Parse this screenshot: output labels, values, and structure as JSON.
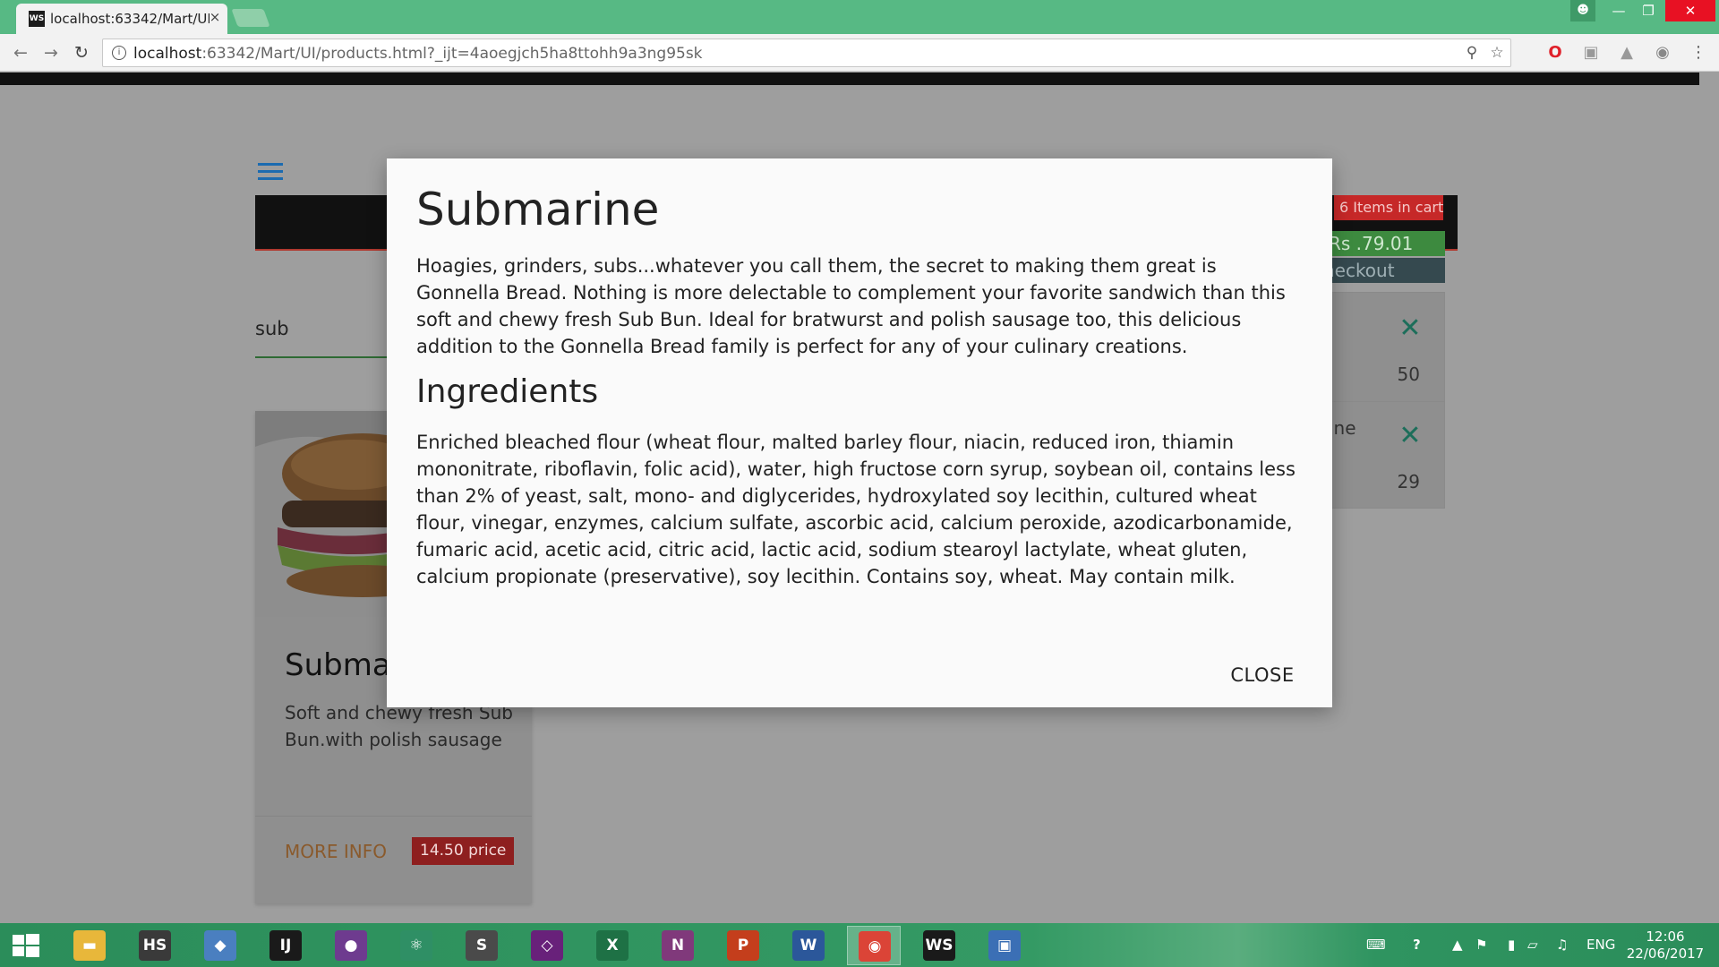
{
  "browser": {
    "tab_title": "localhost:63342/Mart/UI/",
    "tab_favicon": "WS",
    "tab_close": "×",
    "url_host": "localhost",
    "url_rest": ":63342/Mart/UI/products.html?_ijt=4aoegjch5ha8ttohh9a3ng95sk",
    "window_buttons": {
      "minimize": "—",
      "maximize": "❐",
      "close": "✕"
    },
    "icons": [
      "back-icon",
      "forward-icon",
      "reload-icon",
      "info-icon",
      "zoom-icon",
      "star-icon",
      "opera-icon",
      "extension-icon",
      "pdf-icon",
      "camera-icon",
      "menu-icon"
    ]
  },
  "page": {
    "search_value": "sub",
    "cart_badge": "6 Items in cart",
    "cart_total": "Rs .79.01",
    "checkout_label": "Checkout",
    "cart_items": [
      {
        "name": "",
        "qty": "50",
        "remove": "✕"
      },
      {
        "name": "ine",
        "qty": "29",
        "remove": "✕"
      }
    ],
    "product": {
      "title": "Submarine",
      "description": "Soft and chewy fresh Sub Bun.with polish sausage",
      "more_info": "MORE INFO",
      "price": "14.50 price"
    }
  },
  "modal": {
    "title": "Submarine",
    "description": "Hoagies, grinders, subs...whatever you call them, the secret to making them great is Gonnella Bread. Nothing is more delectable to complement your favorite sandwich than this soft and chewy fresh Sub Bun. Ideal for bratwurst and polish sausage too, this delicious addition to the Gonnella Bread family is perfect for any of your culinary creations.",
    "ingredients_heading": "Ingredients",
    "ingredients": "Enriched bleached flour (wheat flour, malted barley flour, niacin, reduced iron, thiamin mononitrate, riboflavin, folic acid), water, high fructose corn syrup, soybean oil, contains less than 2% of yeast, salt, mono- and diglycerides, hydroxylated soy lecithin, cultured wheat flour, vinegar, enzymes, calcium sulfate, ascorbic acid, calcium peroxide, azodicarbonamide, fumaric acid, acetic acid, citric acid, lactic acid, sodium stearoyl lactylate, wheat gluten, calcium propionate (preservative), soy lecithin. Contains soy, wheat. May contain milk.",
    "close_label": "CLOSE"
  },
  "taskbar": {
    "apps": [
      {
        "name": "file-explorer",
        "glyph": "▬",
        "color": "#e8b73a"
      },
      {
        "name": "hs",
        "glyph": "HS",
        "color": "#3a3a3a"
      },
      {
        "name": "virtualbox",
        "glyph": "◆",
        "color": "#4a7fc0"
      },
      {
        "name": "intellij",
        "glyph": "IJ",
        "color": "#1a1a1a"
      },
      {
        "name": "github",
        "glyph": "●",
        "color": "#6e3b8f"
      },
      {
        "name": "atom",
        "glyph": "⚛",
        "color": "#2f8f65"
      },
      {
        "name": "sublime",
        "glyph": "S",
        "color": "#4a4a4a"
      },
      {
        "name": "visual-studio",
        "glyph": "◇",
        "color": "#68217a"
      },
      {
        "name": "excel",
        "glyph": "X",
        "color": "#1e7145"
      },
      {
        "name": "onenote",
        "glyph": "N",
        "color": "#80397b"
      },
      {
        "name": "powerpoint",
        "glyph": "P",
        "color": "#c43e1c"
      },
      {
        "name": "word",
        "glyph": "W",
        "color": "#2b579a"
      },
      {
        "name": "chrome",
        "glyph": "◉",
        "color": "#db4437"
      },
      {
        "name": "webstorm",
        "glyph": "WS",
        "color": "#1a1a1a"
      },
      {
        "name": "photos",
        "glyph": "▣",
        "color": "#3b6fb5"
      }
    ],
    "language": "ENG",
    "time": "12:06",
    "date": "22/06/2017"
  }
}
